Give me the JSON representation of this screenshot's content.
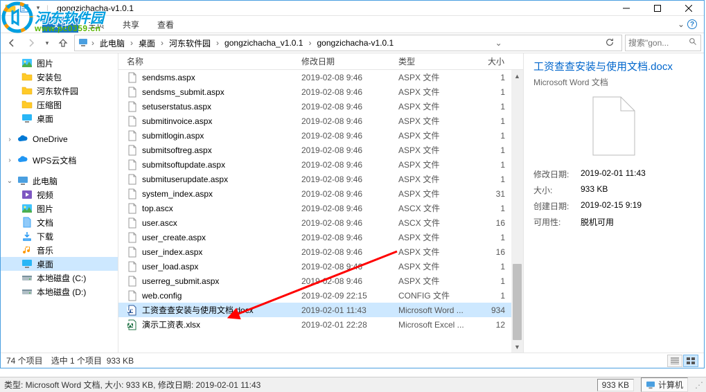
{
  "window": {
    "title": "gongzichacha-v1.0.1"
  },
  "ribbon": {
    "file": "文件",
    "tabs": [
      "主页",
      "共享",
      "查看"
    ]
  },
  "breadcrumb": {
    "segments": [
      "此电脑",
      "桌面",
      "河东软件园",
      "gongzichacha_v1.0.1",
      "gongzichacha-v1.0.1"
    ],
    "search_placeholder": "搜索\"gon..."
  },
  "watermark": {
    "line1": "河东软件园",
    "line2": "www.pc0359.cn"
  },
  "navtree": [
    {
      "label": "图片",
      "icon": "pictures",
      "indent": 1
    },
    {
      "label": "安装包",
      "icon": "folder",
      "indent": 1
    },
    {
      "label": "河东软件园",
      "icon": "folder",
      "indent": 1
    },
    {
      "label": "压缩图",
      "icon": "folder",
      "indent": 1
    },
    {
      "label": "桌面",
      "icon": "desktop",
      "indent": 1
    },
    {
      "spacer": true
    },
    {
      "label": "OneDrive",
      "icon": "onedrive",
      "indent": 0,
      "caret": ">"
    },
    {
      "spacer": true
    },
    {
      "label": "WPS云文档",
      "icon": "wps",
      "indent": 0,
      "caret": ">"
    },
    {
      "spacer": true
    },
    {
      "label": "此电脑",
      "icon": "pc",
      "indent": 0,
      "caret": "v"
    },
    {
      "label": "视频",
      "icon": "videos",
      "indent": 1
    },
    {
      "label": "图片",
      "icon": "pictures",
      "indent": 1
    },
    {
      "label": "文档",
      "icon": "documents",
      "indent": 1
    },
    {
      "label": "下载",
      "icon": "downloads",
      "indent": 1
    },
    {
      "label": "音乐",
      "icon": "music",
      "indent": 1
    },
    {
      "label": "桌面",
      "icon": "desktop",
      "indent": 1,
      "selected": true
    },
    {
      "label": "本地磁盘 (C:)",
      "icon": "disk",
      "indent": 1
    },
    {
      "label": "本地磁盘 (D:)",
      "icon": "disk",
      "indent": 1
    }
  ],
  "columns": {
    "name": "名称",
    "date": "修改日期",
    "type": "类型",
    "size": "大小"
  },
  "files": [
    {
      "name": "sendsms.aspx",
      "date": "2019-02-08 9:46",
      "type": "ASPX 文件",
      "size": "1",
      "icon": "file"
    },
    {
      "name": "sendsms_submit.aspx",
      "date": "2019-02-08 9:46",
      "type": "ASPX 文件",
      "size": "1",
      "icon": "file"
    },
    {
      "name": "setuserstatus.aspx",
      "date": "2019-02-08 9:46",
      "type": "ASPX 文件",
      "size": "1",
      "icon": "file"
    },
    {
      "name": "submitinvoice.aspx",
      "date": "2019-02-08 9:46",
      "type": "ASPX 文件",
      "size": "1",
      "icon": "file"
    },
    {
      "name": "submitlogin.aspx",
      "date": "2019-02-08 9:46",
      "type": "ASPX 文件",
      "size": "1",
      "icon": "file"
    },
    {
      "name": "submitsoftreg.aspx",
      "date": "2019-02-08 9:46",
      "type": "ASPX 文件",
      "size": "1",
      "icon": "file"
    },
    {
      "name": "submitsoftupdate.aspx",
      "date": "2019-02-08 9:46",
      "type": "ASPX 文件",
      "size": "1",
      "icon": "file"
    },
    {
      "name": "submituserupdate.aspx",
      "date": "2019-02-08 9:46",
      "type": "ASPX 文件",
      "size": "1",
      "icon": "file"
    },
    {
      "name": "system_index.aspx",
      "date": "2019-02-08 9:46",
      "type": "ASPX 文件",
      "size": "31",
      "icon": "file"
    },
    {
      "name": "top.ascx",
      "date": "2019-02-08 9:46",
      "type": "ASCX 文件",
      "size": "1",
      "icon": "file"
    },
    {
      "name": "user.ascx",
      "date": "2019-02-08 9:46",
      "type": "ASCX 文件",
      "size": "16",
      "icon": "file"
    },
    {
      "name": "user_create.aspx",
      "date": "2019-02-08 9:46",
      "type": "ASPX 文件",
      "size": "1",
      "icon": "file"
    },
    {
      "name": "user_index.aspx",
      "date": "2019-02-08 9:46",
      "type": "ASPX 文件",
      "size": "16",
      "icon": "file"
    },
    {
      "name": "user_load.aspx",
      "date": "2019-02-08 9:46",
      "type": "ASPX 文件",
      "size": "1",
      "icon": "file"
    },
    {
      "name": "userreg_submit.aspx",
      "date": "2019-02-08 9:46",
      "type": "ASPX 文件",
      "size": "1",
      "icon": "file"
    },
    {
      "name": "web.config",
      "date": "2019-02-09 22:15",
      "type": "CONFIG 文件",
      "size": "1",
      "icon": "file"
    },
    {
      "name": "工资查查安装与使用文档.docx",
      "date": "2019-02-01 11:43",
      "type": "Microsoft Word ...",
      "size": "934",
      "icon": "docx",
      "selected": true
    },
    {
      "name": "演示工资表.xlsx",
      "date": "2019-02-01 22:28",
      "type": "Microsoft Excel ...",
      "size": "12",
      "icon": "xlsx"
    }
  ],
  "preview": {
    "title": "工资查查安装与使用文档.docx",
    "type": "Microsoft Word 文档",
    "props": [
      {
        "label": "修改日期:",
        "value": "2019-02-01 11:43"
      },
      {
        "label": "大小:",
        "value": "933 KB"
      },
      {
        "label": "创建日期:",
        "value": "2019-02-15 9:19"
      },
      {
        "label": "可用性:",
        "value": "脱机可用"
      }
    ]
  },
  "statusbar": {
    "count": "74 个项目",
    "selection": "选中 1 个项目",
    "size": "933 KB"
  },
  "bottombar": {
    "info": "类型: Microsoft Word 文档, 大小: 933 KB, 修改日期: 2019-02-01 11:43",
    "size": "933 KB",
    "computer": "计算机"
  }
}
